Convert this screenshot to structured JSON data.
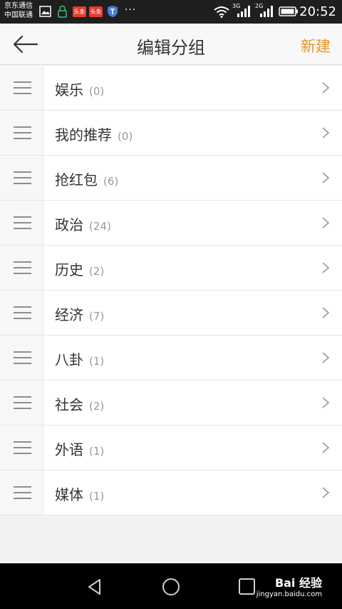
{
  "status_bar": {
    "carrier_line1": "京东通信",
    "carrier_line2": "中国联通",
    "notif_label_1": "头条",
    "notif_label_2": "头条",
    "more": "···",
    "network_1": "3G",
    "network_2": "2G",
    "time": "20:52"
  },
  "header": {
    "title": "编辑分组",
    "new_label": "新建"
  },
  "groups": [
    {
      "name": "娱乐",
      "count": "(0)"
    },
    {
      "name": "我的推荐",
      "count": "(0)"
    },
    {
      "name": "抢红包",
      "count": "(6)"
    },
    {
      "name": "政治",
      "count": "(24)"
    },
    {
      "name": "历史",
      "count": "(2)"
    },
    {
      "name": "经济",
      "count": "(7)"
    },
    {
      "name": "八卦",
      "count": "(1)"
    },
    {
      "name": "社会",
      "count": "(2)"
    },
    {
      "name": "外语",
      "count": "(1)"
    },
    {
      "name": "媒体",
      "count": "(1)"
    }
  ],
  "watermark": {
    "brand": "Bai 经验",
    "url": "jingyan.baidu.com"
  },
  "colors": {
    "accent": "#e8942a",
    "status_bg": "#1f1f1f",
    "nav_bg": "#000000"
  }
}
